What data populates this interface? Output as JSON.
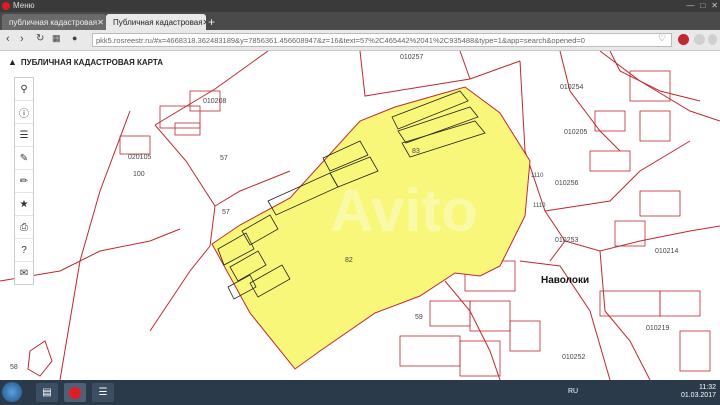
{
  "browser": {
    "menu_label": "Меню",
    "tabs": [
      {
        "label": "публичная кадастровая"
      },
      {
        "label": "Публичная кадастровая"
      }
    ],
    "new_tab": "+",
    "url": "pkk5.rosreestr.ru/#x=4668318.362483189&y=7856361.456608947&z=16&text=57%2C465442%2041%2C935488&type=1&app=search&opened=0"
  },
  "map": {
    "title": "ПУБЛИЧНАЯ КАДАСТРОВАЯ КАРТА",
    "tools": [
      "search-icon",
      "info-icon",
      "layers-icon",
      "pencil-icon",
      "measure-icon",
      "star-icon",
      "print-icon",
      "help-icon",
      "mail-icon"
    ],
    "place_label": "Наволоки",
    "parcel_labels": [
      {
        "text": "010208"
      },
      {
        "text": "010257"
      },
      {
        "text": "010254"
      },
      {
        "text": "010205"
      },
      {
        "text": "010256"
      },
      {
        "text": "010253"
      },
      {
        "text": "010214"
      },
      {
        "text": "010219"
      },
      {
        "text": "010252"
      },
      {
        "text": "020105"
      },
      {
        "text": "57"
      },
      {
        "text": "57"
      },
      {
        "text": "82"
      },
      {
        "text": "59"
      },
      {
        "text": "100"
      },
      {
        "text": "1110"
      },
      {
        "text": "1110"
      },
      {
        "text": "58"
      },
      {
        "text": "83"
      }
    ],
    "highlight_color": "#f8f77a",
    "border_color": "#c0282d"
  },
  "taskbar": {
    "lang": "RU",
    "time": "11:32",
    "date": "01.03.2017"
  }
}
